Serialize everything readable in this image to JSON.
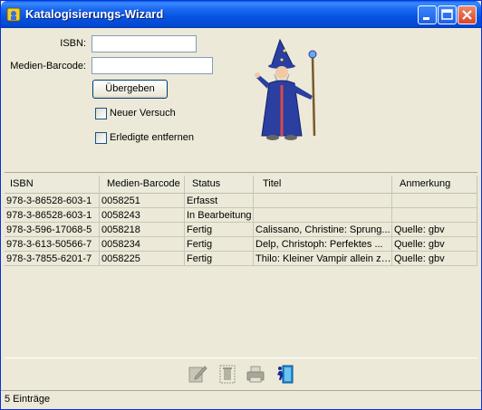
{
  "window": {
    "title": "Katalogisierungs-Wizard"
  },
  "form": {
    "isbn_label": "ISBN:",
    "isbn_value": "",
    "barcode_label": "Medien-Barcode:",
    "barcode_value": "",
    "submit_label": "Übergeben",
    "retry_label": "Neuer Versuch",
    "retry_checked": false,
    "remove_done_label": "Erledigte entfernen",
    "remove_done_checked": false
  },
  "table": {
    "columns": [
      "ISBN",
      "Medien-Barcode",
      "Status",
      "Titel",
      "Anmerkung"
    ],
    "rows": [
      {
        "isbn": "978-3-86528-603-1",
        "barcode": "0058251",
        "status": "Erfasst",
        "title": "",
        "note": ""
      },
      {
        "isbn": "978-3-86528-603-1",
        "barcode": "0058243",
        "status": "In Bearbeitung",
        "title": "",
        "note": ""
      },
      {
        "isbn": "978-3-596-17068-5",
        "barcode": "0058218",
        "status": "Fertig",
        "title": "Calissano, Christine: Sprung...",
        "note": "Quelle: gbv"
      },
      {
        "isbn": "978-3-613-50566-7",
        "barcode": "0058234",
        "status": "Fertig",
        "title": "Delp, Christoph: Perfektes ...",
        "note": "Quelle: gbv"
      },
      {
        "isbn": "978-3-7855-6201-7",
        "barcode": "0058225",
        "status": "Fertig",
        "title": "Thilo: Kleiner Vampir allein zu...",
        "note": "Quelle: gbv"
      }
    ]
  },
  "toolbar": {
    "icons": [
      "edit-icon",
      "delete-icon",
      "print-icon",
      "exit-icon"
    ]
  },
  "status": {
    "text": "5 Einträge"
  },
  "colors": {
    "titlebar": "#0553e0",
    "window_bg": "#ece9d8",
    "wizard_robe": "#2a3fa0"
  }
}
